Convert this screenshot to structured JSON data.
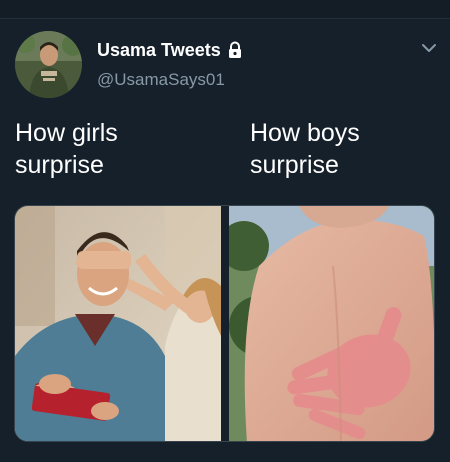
{
  "header": {
    "display_name": "Usama Tweets",
    "handle": "@UsamaSays01",
    "protected_icon": "lock-icon",
    "menu_icon": "chevron-down-icon"
  },
  "tweet": {
    "left_text": "How girls\nsurprise",
    "right_text": "How boys\nsurprise"
  },
  "media": {
    "left_photo": "man-blindfolded-with-gift-photo",
    "right_photo": "back-with-handprint-photo"
  },
  "colors": {
    "background": "#15202b",
    "secondary_text": "#8899a6",
    "primary_text": "#ffffff"
  }
}
